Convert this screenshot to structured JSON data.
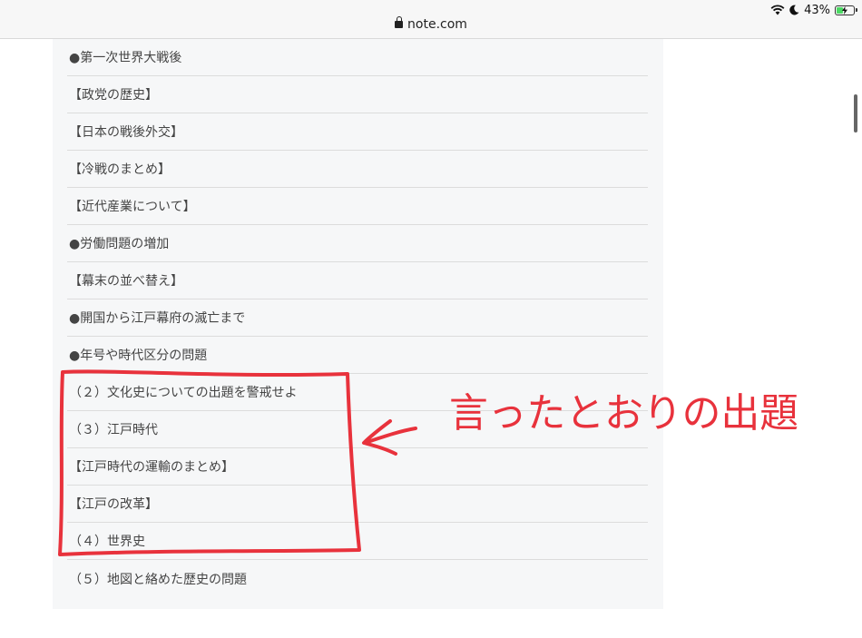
{
  "browser": {
    "url": "note.com",
    "battery_percent_label": "43%",
    "battery_level": 0.43,
    "icons": [
      "wifi-icon",
      "moon-icon",
      "battery-icon",
      "lock-icon"
    ]
  },
  "list": {
    "items": [
      {
        "label": "●第一次世界大戦後"
      },
      {
        "label": "【政党の歴史】"
      },
      {
        "label": "【日本の戦後外交】"
      },
      {
        "label": "【冷戦のまとめ】"
      },
      {
        "label": "【近代産業について】"
      },
      {
        "label": "●労働問題の増加"
      },
      {
        "label": "【幕末の並べ替え】"
      },
      {
        "label": "●開国から江戸幕府の滅亡まで"
      },
      {
        "label": "●年号や時代区分の問題"
      },
      {
        "label": "（２）文化史についての出題を警戒せよ"
      },
      {
        "label": "（３）江戸時代"
      },
      {
        "label": "【江戸時代の運輸のまとめ】"
      },
      {
        "label": "【江戸の改革】"
      },
      {
        "label": "（４）世界史"
      },
      {
        "label": "（５）地図と絡めた歴史の問題"
      }
    ]
  },
  "annotation": {
    "text": "言ったとおりの出題",
    "color": "#e8323c"
  }
}
